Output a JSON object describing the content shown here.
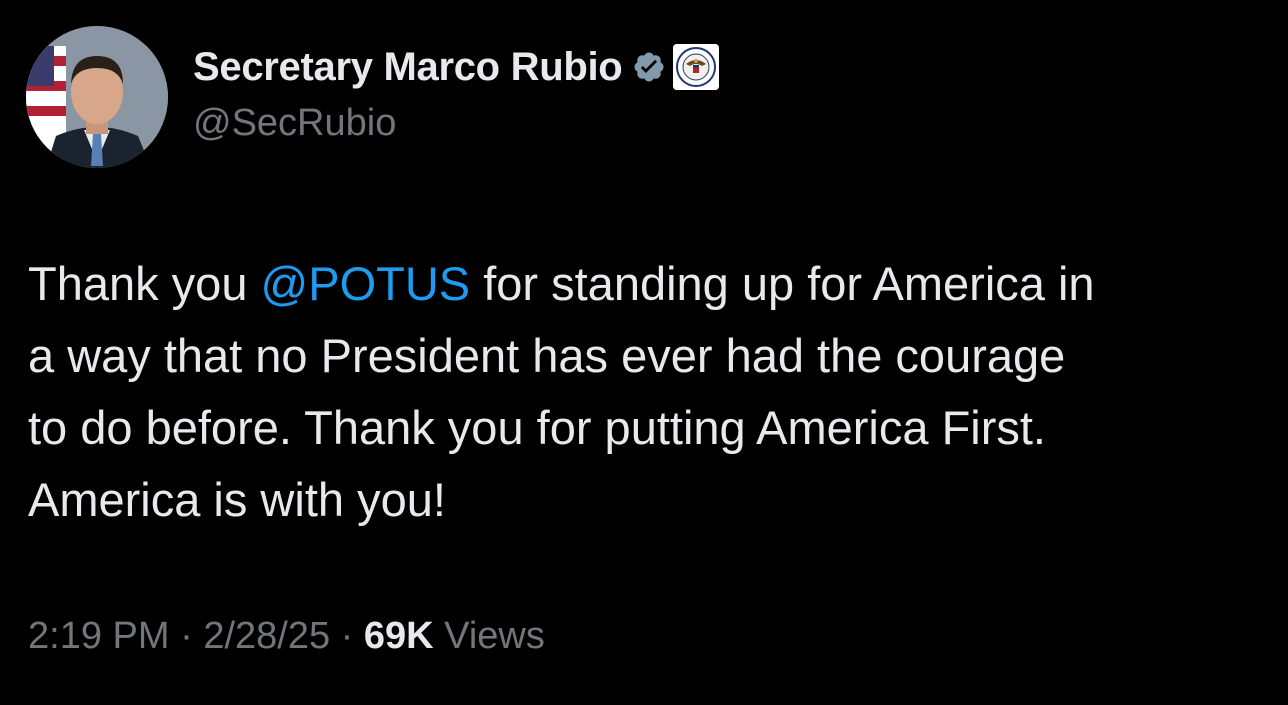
{
  "author": {
    "display_name": "Secretary Marco Rubio",
    "handle": "@SecRubio",
    "verified_badge_icon": "verified-badge-icon",
    "affiliate_badge_icon": "state-department-seal-icon",
    "verified_color": "#829aab"
  },
  "tweet": {
    "text_lines": [
      {
        "before": "Thank you ",
        "mention": "@POTUS",
        "after": " for standing up for America in"
      },
      {
        "text": "a way that no President has ever had the courage"
      },
      {
        "text": "to do before. Thank you for putting America First."
      },
      {
        "text": "America is with you!"
      }
    ]
  },
  "meta": {
    "time": "2:19 PM",
    "sep1": " · ",
    "date": "2/28/25",
    "sep2": " · ",
    "views_count": "69K",
    "views_label": " Views"
  },
  "colors": {
    "background": "#000000",
    "text": "#e7e9ea",
    "secondary": "#71767b",
    "mention": "#1d9bf0"
  }
}
